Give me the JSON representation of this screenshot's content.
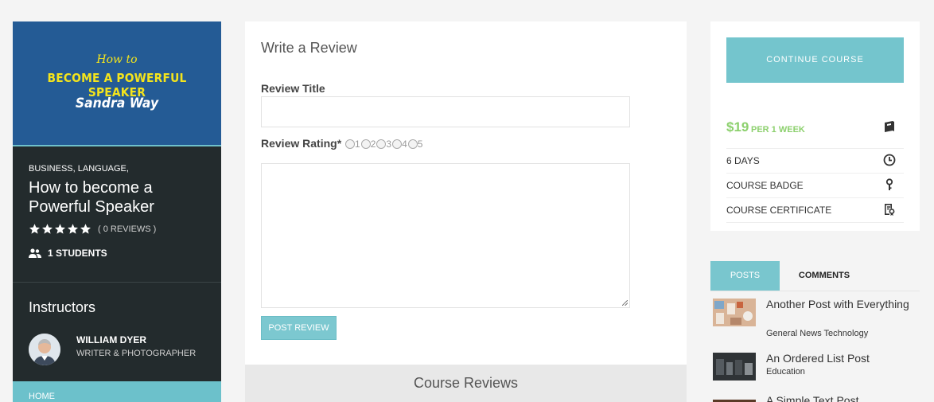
{
  "course_cover": {
    "line1": "How to",
    "line2": "BECOME A POWERFUL SPEAKER",
    "line3": "Sandra Way"
  },
  "course_info": {
    "categories": "BUSINESS, LANGUAGE,",
    "title": "How to become a Powerful Speaker",
    "rating_stars": 5,
    "reviews": "( 0 REVIEWS )",
    "students": "1 STUDENTS"
  },
  "instructors": {
    "heading": "Instructors",
    "name": "WILLIAM DYER",
    "role": "WRITER & PHOTOGRAPHER"
  },
  "left_nav": {
    "home_label": "HOME"
  },
  "review_form": {
    "heading": "Write a Review",
    "title_label": "Review Title",
    "title_value": "",
    "rating_label": "Review Rating*",
    "rating_options": [
      "1",
      "2",
      "3",
      "4",
      "5"
    ],
    "body_value": "",
    "submit_label": "POST REVIEW"
  },
  "course_reviews": {
    "heading": "Course Reviews"
  },
  "course_card": {
    "continue_label": "CONTINUE COURSE",
    "price": "$19",
    "per": "PER 1 WEEK",
    "rows": [
      {
        "label": "6 DAYS",
        "icon": "clock-icon"
      },
      {
        "label": "COURSE BADGE",
        "icon": "badge-icon"
      },
      {
        "label": "COURSE CERTIFICATE",
        "icon": "certificate-icon"
      }
    ]
  },
  "sidebar_tabs": {
    "posts_label": "POSTS",
    "comments_label": "COMMENTS"
  },
  "posts": [
    {
      "title": "Another Post with Everything",
      "category": "General News Technology"
    },
    {
      "title": "An Ordered List Post",
      "category": "Education"
    },
    {
      "title": "A Simple Text Post",
      "category": ""
    }
  ],
  "colors": {
    "accent": "#74c5cd",
    "price_green": "#8cd06d",
    "dark_panel": "#232b2d",
    "cover_blue": "#245b95"
  }
}
